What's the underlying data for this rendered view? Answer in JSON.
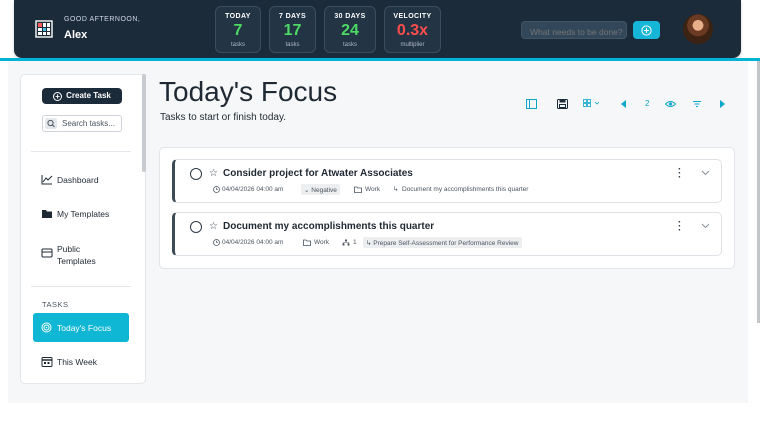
{
  "header": {
    "greeting": "GOOD AFTERNOON,",
    "user_name": "Alex",
    "stats": [
      {
        "label": "TODAY",
        "value": "7",
        "sub": "tasks",
        "color": "green"
      },
      {
        "label": "7 DAYS",
        "value": "17",
        "sub": "tasks",
        "color": "green"
      },
      {
        "label": "30 DAYS",
        "value": "24",
        "sub": "tasks",
        "color": "green"
      },
      {
        "label": "VELOCITY",
        "value": "0.3x",
        "sub": "multiplier",
        "color": "red"
      }
    ],
    "search_placeholder": "What needs to be done?",
    "accent_color": "#16b6d8"
  },
  "sidebar": {
    "create_label": "Create Task",
    "search_placeholder": "Search tasks...",
    "nav": [
      {
        "label": "Dashboard",
        "icon": "chart-line-icon"
      },
      {
        "label": "My Templates",
        "icon": "folder-icon"
      },
      {
        "label": "Public Templates",
        "icon": "inbox-icon"
      }
    ],
    "section_label": "TASKS",
    "tasks_nav": [
      {
        "label": "Today's Focus",
        "icon": "target-icon",
        "active": true
      },
      {
        "label": "This Week",
        "icon": "calendar-icon",
        "active": false
      }
    ]
  },
  "main": {
    "title": "Today's Focus",
    "subtitle": "Tasks to start or finish today.",
    "toolbar": {
      "count": "2"
    },
    "tasks": [
      {
        "title": "Consider project for Atwater Associates",
        "date": "04/04/2026 04:00 am",
        "sentiment": "Negative",
        "category": "Work",
        "link": "Document my accomplishments this quarter"
      },
      {
        "title": "Document my accomplishments this quarter",
        "date": "04/04/2026 04:00 am",
        "category": "Work",
        "hierarchy": "1",
        "link": "Prepare Self-Assessment for Performance Review"
      }
    ]
  }
}
